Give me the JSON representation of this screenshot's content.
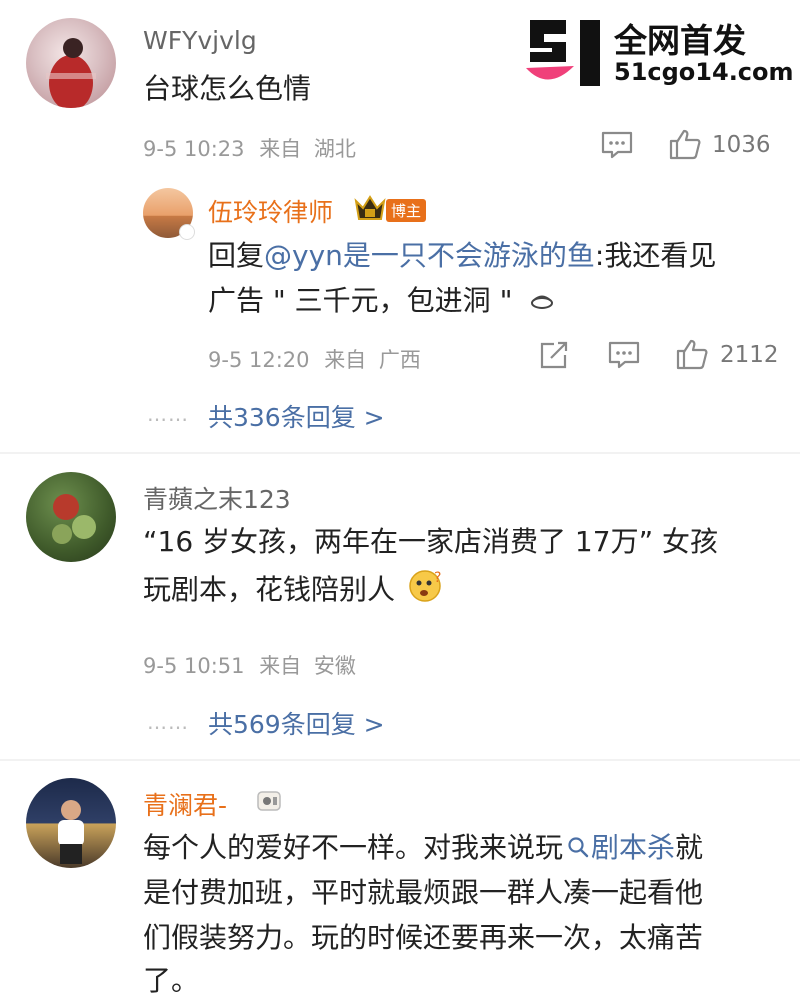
{
  "watermark": {
    "headline": "全网首发",
    "site": "51cgo14.com",
    "logo_text": "51"
  },
  "comments": [
    {
      "username": "WFYvjvlg",
      "text": "台球怎么色情",
      "time": "9-5 10:23",
      "from_label": "来自",
      "location": "湖北",
      "likes": "1036"
    },
    {
      "username": "青蘋之末123",
      "text_line1": "“16 岁女孩，两年在一家店消费了 17万” 女孩",
      "text_line2": "玩剧本，花钱陪别人",
      "time": "9-5 10:51",
      "from_label": "来自",
      "location": "安徽",
      "replies": "共569条回复 >"
    },
    {
      "username": "青澜君-",
      "text_line1_a": "每个人的爱好不一样。对我来说玩",
      "topic": "剧本杀",
      "text_line1_b": "就",
      "text_line2": "是付费加班，平时就最烦跟一群人凑一起看他",
      "text_line3": "们假装努力。玩的时候还要再来一次，太痛苦",
      "text_line4": "了。"
    }
  ],
  "reply": {
    "username": "伍玲玲律师",
    "badge": "博主",
    "reply_prefix": "回复",
    "mention": "@yyn是一只不会游泳的鱼",
    "text_a": ":我还看见",
    "text_b": "广告 \" 三千元，包进洞 \"",
    "time": "9-5 12:20",
    "from_label": "来自",
    "location": "广西",
    "likes": "2112",
    "replies": "共336条回复 >"
  },
  "dots": "……",
  "colors": {
    "link": "#4a6fa5",
    "orange_name": "#e8701a",
    "logo_black": "#111111",
    "logo_pink": "#f0407a"
  }
}
